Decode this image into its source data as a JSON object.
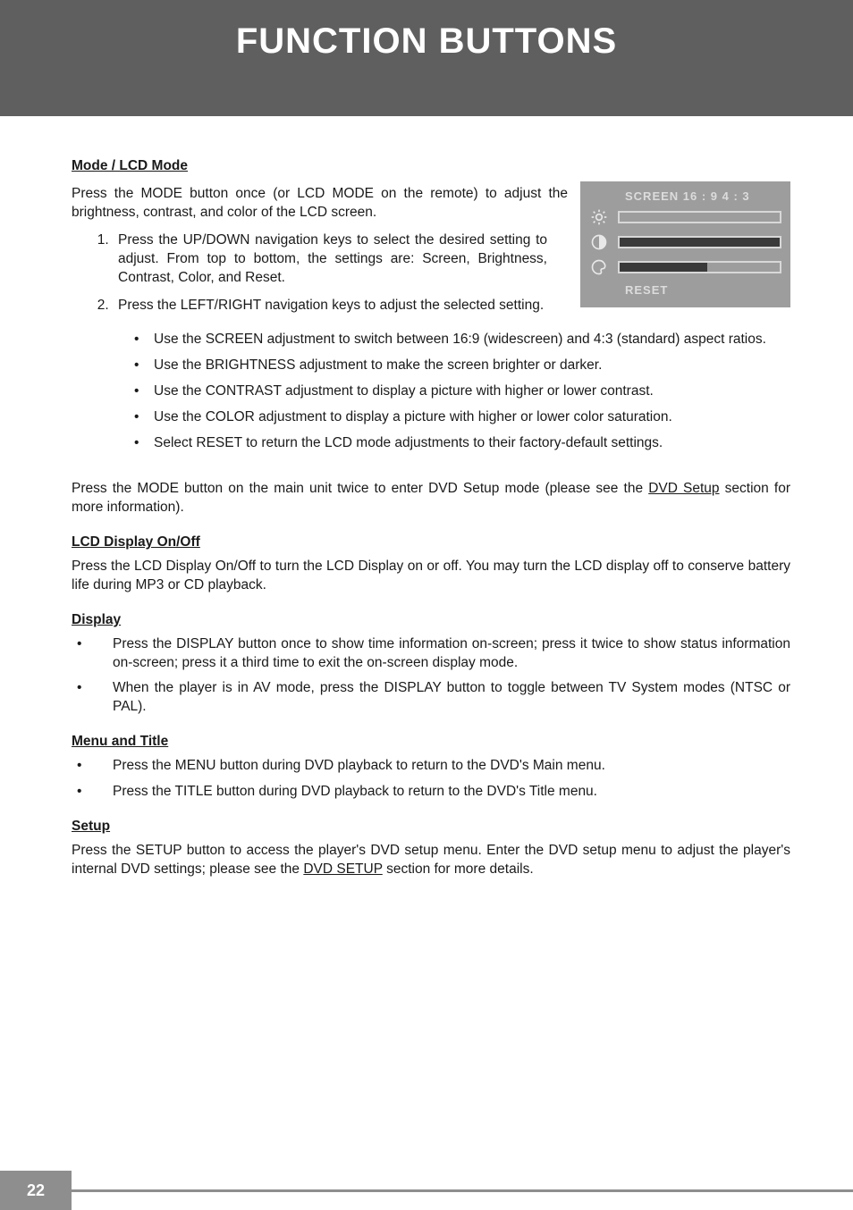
{
  "header": {
    "title": "FUNCTION BUTTONS"
  },
  "mode": {
    "heading": "Mode / LCD Mode",
    "intro": "Press the MODE button once (or LCD MODE on the remote) to adjust the brightness, contrast, and color of the LCD screen.",
    "step1": "Press the UP/DOWN navigation keys to select the desired setting to adjust. From top to bottom, the settings are: Screen, Brightness, Contrast, Color, and Reset.",
    "step2": "Press the LEFT/RIGHT navigation keys to adjust the selected setting.",
    "bullets": [
      "Use the SCREEN adjustment to switch between 16:9 (widescreen) and 4:3 (standard) aspect ratios.",
      "Use the BRIGHTNESS adjustment to make the screen brighter or darker.",
      "Use the CONTRAST adjustment to display a picture with higher or lower contrast.",
      "Use the COLOR adjustment to display a picture with higher or lower color saturation.",
      "Select RESET to return the LCD mode adjustments to their factory-default settings."
    ],
    "closing_pre": "Press the MODE button on the main unit twice to enter DVD Setup mode (please see the ",
    "closing_link": "DVD Setup",
    "closing_post": " section for more information)."
  },
  "osd": {
    "top": "SCREEN 16 : 9   4 : 3",
    "reset": "RESET"
  },
  "lcd": {
    "heading": "LCD Display On/Off",
    "text": "Press the LCD Display On/Off to turn the LCD Display on or off. You may turn the LCD display off to conserve battery life during MP3 or CD playback."
  },
  "display": {
    "heading": "Display",
    "bullets": [
      "Press the DISPLAY button once to show time information on-screen; press it twice to show status information on-screen; press it a third time to exit the on-screen display mode.",
      "When the player is in AV mode, press the DISPLAY button to toggle between TV System modes (NTSC or PAL)."
    ]
  },
  "menu": {
    "heading": "Menu and Title",
    "bullets": [
      "Press the MENU button during DVD playback to return to the DVD's Main menu.",
      "Press the TITLE button during DVD playback to return to the DVD's Title menu."
    ]
  },
  "setup": {
    "heading": "Setup",
    "pre": "Press the SETUP button to access the player's DVD setup menu. Enter the DVD setup menu to adjust the player's internal DVD settings; please see the ",
    "link": "DVD SETUP",
    "post": " section for more details."
  },
  "page": "22"
}
